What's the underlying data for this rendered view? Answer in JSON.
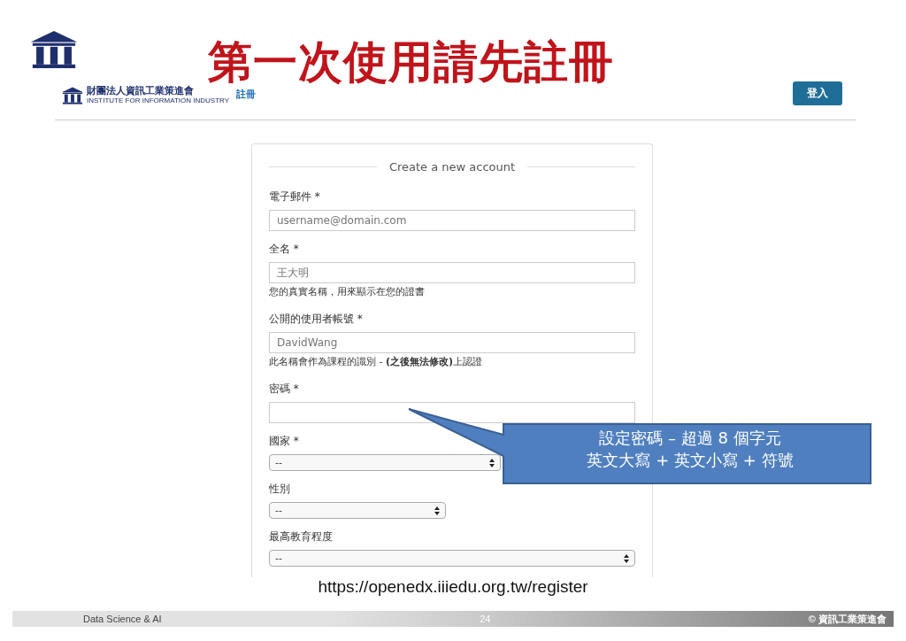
{
  "slide": {
    "title": "第一次使用請先註冊",
    "url": "https://openedx.iiiedu.org.tw/register",
    "footer_left": "Data Science & AI",
    "page_number": "24",
    "footer_right": "© 資訊工業策進會"
  },
  "site_header": {
    "logo_text": "財團法人資訊工業策進會",
    "logo_subtext": "INSTITUTE FOR INFORMATION INDUSTRY",
    "nav_link": "註冊",
    "login_button": "登入"
  },
  "form": {
    "heading": "Create a new account",
    "fields": [
      {
        "kind": "text",
        "label": "電子郵件 *",
        "placeholder": "username@domain.com"
      },
      {
        "kind": "text",
        "label": "全名 *",
        "placeholder": "王大明",
        "hint": "您的真實名稱，用來顯示在您的證書"
      },
      {
        "kind": "text",
        "label": "公開的使用者帳號 *",
        "placeholder": "DavidWang",
        "hint": "此名稱會作為課程的識別 - **(之後無法修改)**上認證"
      },
      {
        "kind": "password",
        "label": "密碼 *"
      },
      {
        "kind": "select",
        "label": "國家 *",
        "value": "--"
      },
      {
        "kind": "select",
        "label": "性別",
        "value": "--"
      },
      {
        "kind": "select",
        "label": "最高教育程度",
        "value": "--"
      }
    ]
  },
  "callout": {
    "lines": [
      "設定密碼 – 超過 8 個字元",
      "英文大寫 + 英文小寫 + 符號"
    ]
  }
}
